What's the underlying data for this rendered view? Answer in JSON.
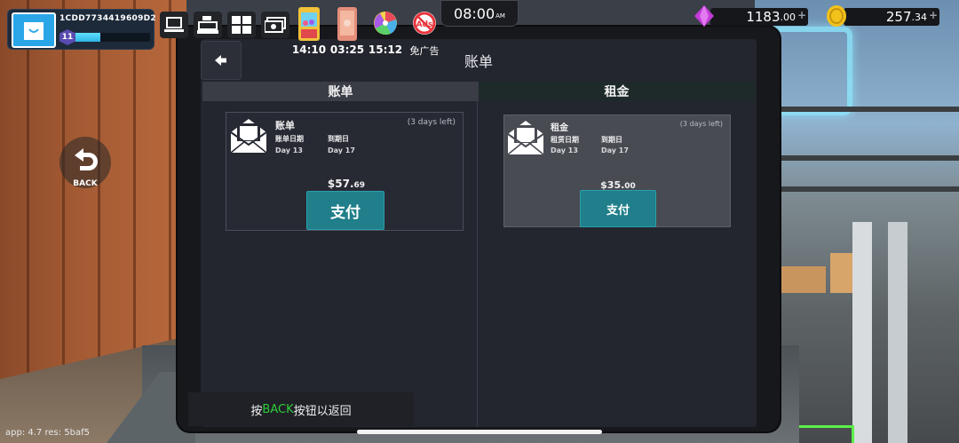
{
  "hud": {
    "player_id": "1CDD7734419609D2",
    "level": "11",
    "xp_progress": 0.35,
    "clock_time": "08:00",
    "clock_period": "AM",
    "gems_whole": "1183",
    "gems_decimal": ".00",
    "coins_whole": "257",
    "coins_decimal": ".34",
    "plus_symbol": "+"
  },
  "timers": [
    {
      "icon": "claw-machine-icon",
      "time": "14:10"
    },
    {
      "icon": "phone-card-icon",
      "time": "03:25"
    },
    {
      "icon": "prize-wheel-icon",
      "time": "15:12"
    },
    {
      "icon": "no-ads-icon",
      "label": "免广告"
    }
  ],
  "toolbar": {
    "icons": [
      "computer-icon",
      "cash-register-icon",
      "grid-apps-icon",
      "cash-stack-icon"
    ]
  },
  "side_back": {
    "label": "BACK"
  },
  "screen": {
    "title": "账单",
    "tabs": [
      {
        "label": "账单",
        "active": true
      },
      {
        "label": "租金",
        "active": false
      }
    ],
    "bill_card": {
      "title": "账单",
      "days_left": "(3 days left)",
      "date_label": "账单日期",
      "date_value": "Day 13",
      "due_label": "到期日",
      "due_value": "Day 17",
      "amount_main": "$57.",
      "amount_cents": "69",
      "pay_label": "支付"
    },
    "rent_card": {
      "title": "租金",
      "days_left": "(3 days left)",
      "date_label": "租赁日期",
      "date_value": "Day 13",
      "due_label": "到期日",
      "due_value": "Day 17",
      "amount_main": "$35.",
      "amount_cents": "00",
      "pay_label": "支付"
    }
  },
  "hint": {
    "prefix": "按",
    "key": "BACK",
    "suffix": "按钮以返回"
  },
  "app_info": "app: 4.7 res: 5baf5",
  "colors": {
    "accent_teal": "#207f8a",
    "xp_cyan": "#2eb5e6",
    "hint_green": "#2ecc3a",
    "gem_purple": "#c23bd8",
    "coin_gold": "#f2c21b"
  }
}
